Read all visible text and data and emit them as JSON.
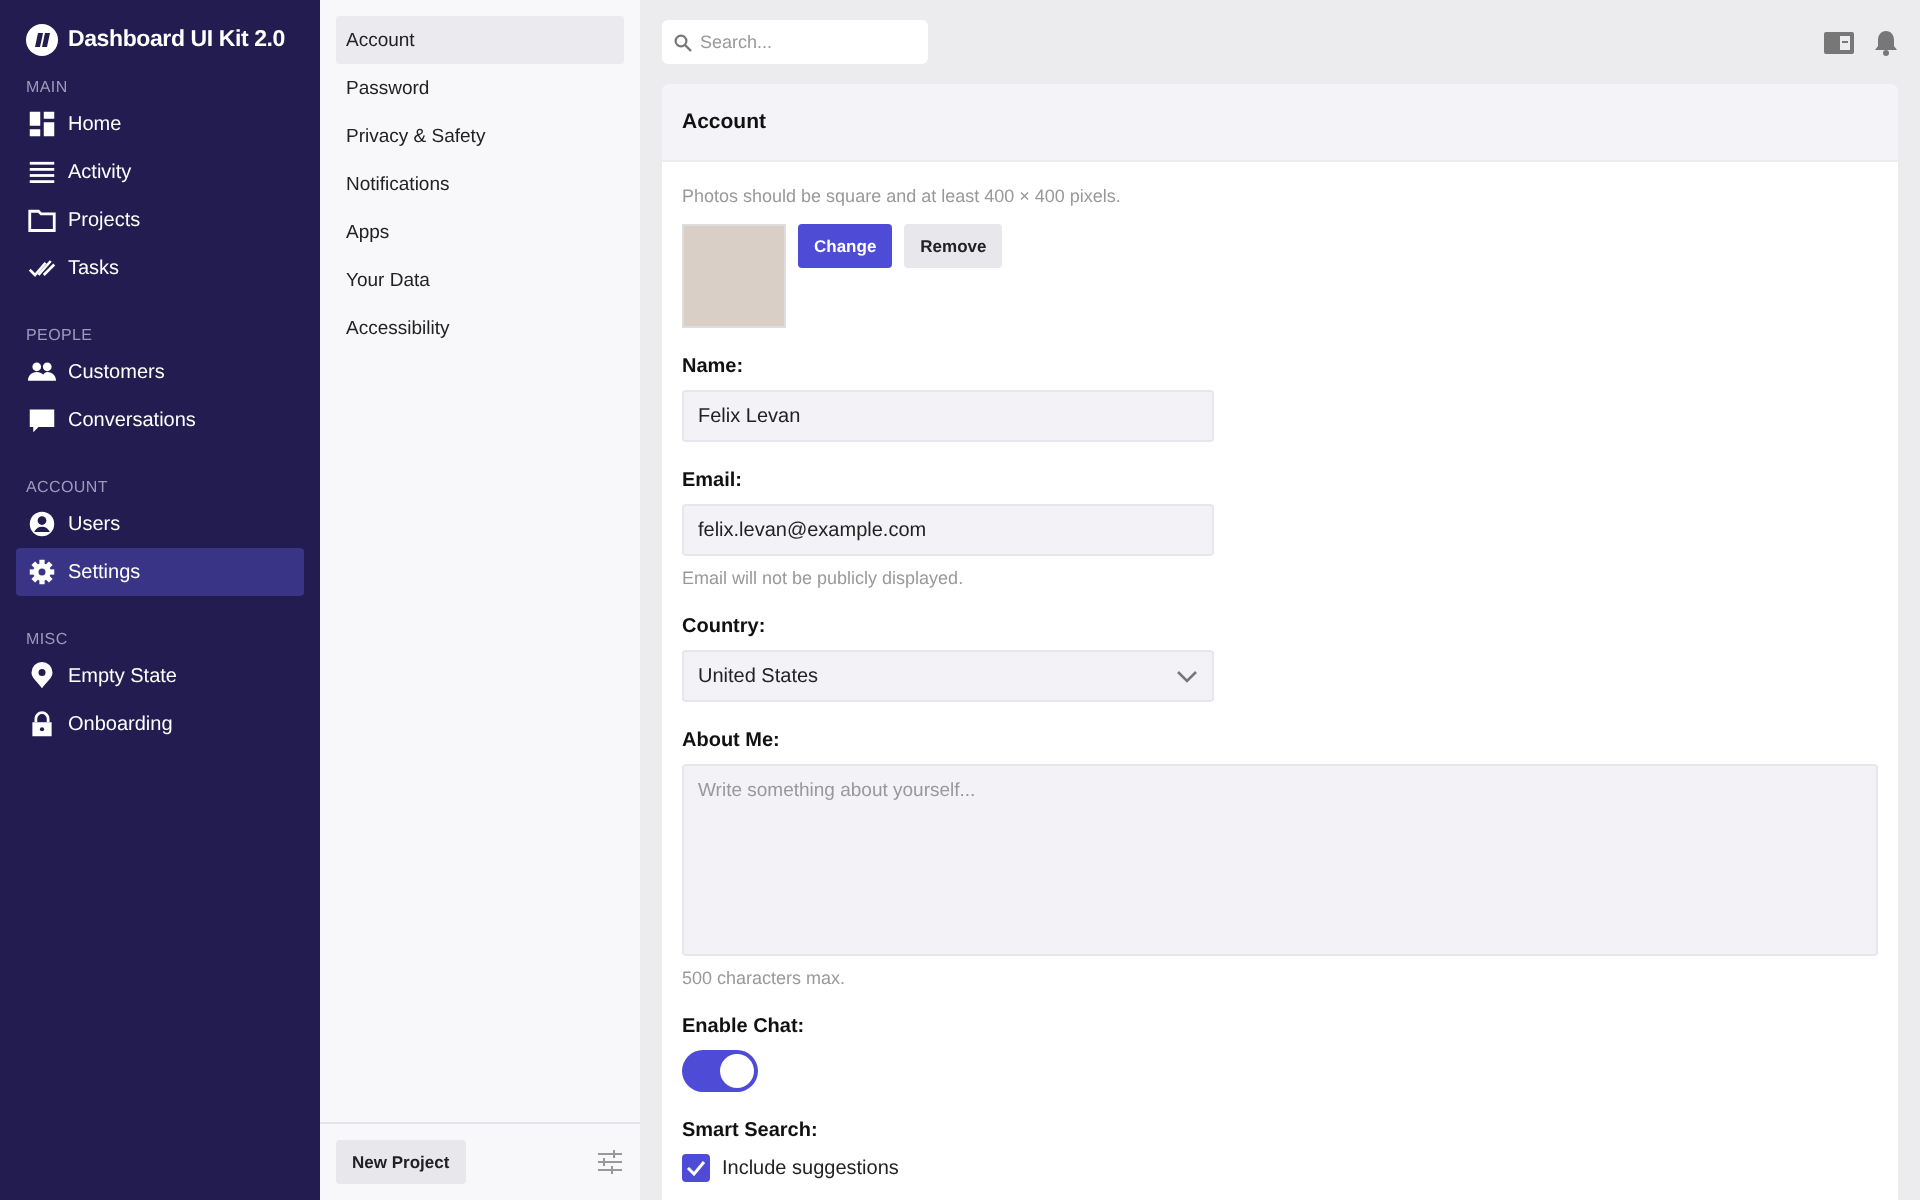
{
  "sidebar": {
    "brand": "Dashboard UI Kit 2.0",
    "sections": [
      {
        "heading": "MAIN",
        "items": [
          {
            "label": "Home",
            "selected": false
          },
          {
            "label": "Activity",
            "selected": false
          },
          {
            "label": "Projects",
            "selected": false
          },
          {
            "label": "Tasks",
            "selected": false
          }
        ]
      },
      {
        "heading": "PEOPLE",
        "items": [
          {
            "label": "Customers",
            "selected": false
          },
          {
            "label": "Conversations",
            "selected": false
          }
        ]
      },
      {
        "heading": "ACCOUNT",
        "items": [
          {
            "label": "Users",
            "selected": false
          },
          {
            "label": "Settings",
            "selected": true
          }
        ]
      },
      {
        "heading": "MISC",
        "items": [
          {
            "label": "Empty State",
            "selected": false
          },
          {
            "label": "Onboarding",
            "selected": false
          }
        ]
      }
    ]
  },
  "settings_nav": {
    "items": [
      {
        "label": "Account",
        "selected": true
      },
      {
        "label": "Password",
        "selected": false
      },
      {
        "label": "Privacy & Safety",
        "selected": false
      },
      {
        "label": "Notifications",
        "selected": false
      },
      {
        "label": "Apps",
        "selected": false
      },
      {
        "label": "Your Data",
        "selected": false
      },
      {
        "label": "Accessibility",
        "selected": false
      }
    ],
    "button": "New Project"
  },
  "topbar": {
    "search": {
      "placeholder": "Search..."
    }
  },
  "card": {
    "title": "Account",
    "photo_hint": "Photos should be square and at least 400 × 400 pixels.",
    "photo_buttons": [
      "Change",
      "Remove"
    ],
    "fields": [
      {
        "kind": "text",
        "label": "Name:",
        "value": "Felix Levan"
      },
      {
        "kind": "text",
        "label": "Email:",
        "value": "felix.levan@example.com",
        "hint": "Email will not be publicly displayed."
      },
      {
        "kind": "select",
        "label": "Country:",
        "value": "United States"
      },
      {
        "kind": "textarea",
        "label": "About Me:",
        "placeholder": "Write something about yourself...",
        "hint": "500 characters max."
      },
      {
        "kind": "toggle",
        "label": "Enable Chat:",
        "on": true
      },
      {
        "kind": "checkbox",
        "label": "Smart Search:",
        "options": [
          {
            "label": "Include suggestions",
            "checked": true
          }
        ]
      }
    ]
  }
}
